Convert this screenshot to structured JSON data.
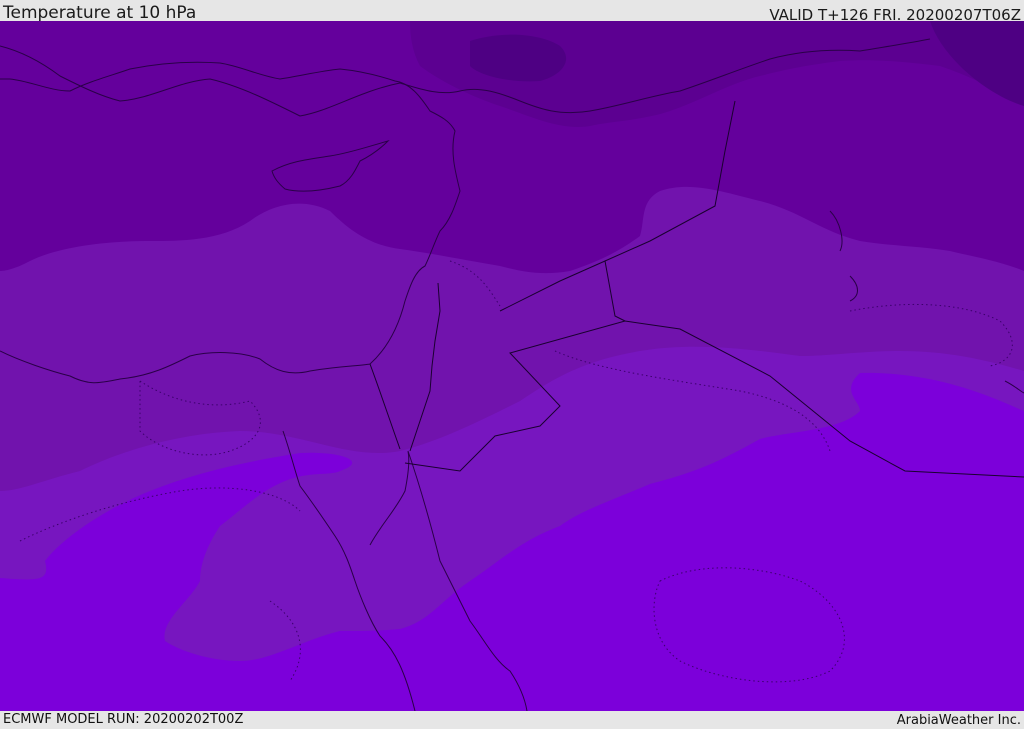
{
  "header": {
    "title": "Temperature at 10 hPa",
    "valid": "VALID T+126 FRI. 20200207T06Z"
  },
  "footer": {
    "model_run": "ECMWF MODEL RUN: 20200202T00Z",
    "credit": "ArabiaWeather Inc."
  },
  "legend_colors": {
    "coldest": "#4e0083",
    "cold": "#5c0091",
    "cool": "#64009c",
    "mid": "#7113ad",
    "mild": "#7716bf",
    "warm": "#7c00da"
  }
}
